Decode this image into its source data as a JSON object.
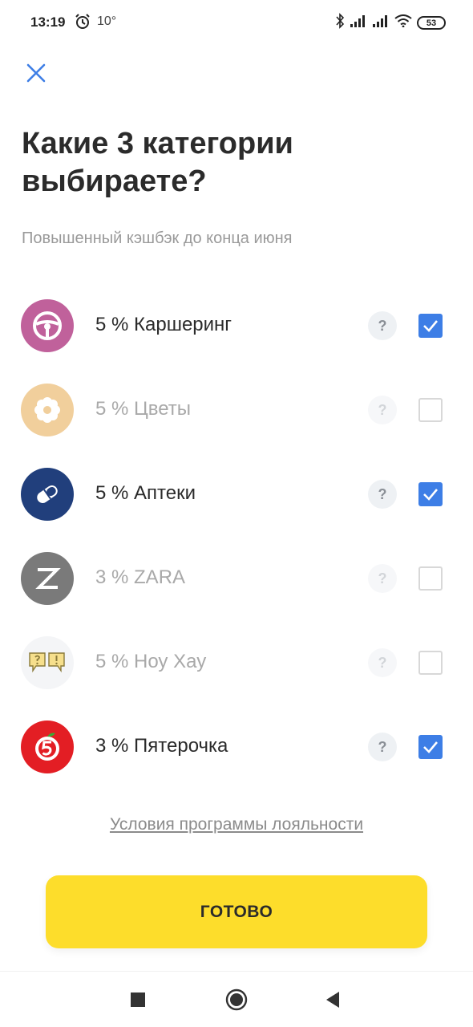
{
  "status_bar": {
    "time": "13:19",
    "temperature": "10°",
    "battery": "53",
    "icons": [
      "alarm-icon",
      "bluetooth-icon",
      "signal-icon",
      "signal-icon",
      "wifi-icon",
      "battery-icon"
    ]
  },
  "header": {
    "close_icon": "close-icon",
    "title": "Какие 3 категории выбираете?",
    "subtitle": "Повышенный кэшбэк до конца июня"
  },
  "categories": [
    {
      "label": "5 % Каршеринг",
      "icon": "steering-wheel-icon",
      "selected": true,
      "icon_color": "#c0619b"
    },
    {
      "label": "5 % Цветы",
      "icon": "flower-icon",
      "selected": false,
      "icon_color": "#f1cf9c"
    },
    {
      "label": "5 % Аптеки",
      "icon": "pill-icon",
      "selected": true,
      "icon_color": "#213f7c"
    },
    {
      "label": "3 % ZARA",
      "icon": "zara-logo-icon",
      "selected": false,
      "icon_color": "#7a7a7a"
    },
    {
      "label": "5 % Ноу Хау",
      "icon": "speech-bubbles-icon",
      "selected": false,
      "icon_color": "#f4f5f7"
    },
    {
      "label": "3 % Пятерочка",
      "icon": "pyaterochka-logo-icon",
      "selected": true,
      "icon_color": "#e31e24"
    }
  ],
  "help_label": "?",
  "loyalty_link": "Условия программы лояльности",
  "done_button": "ГОТОВО",
  "colors": {
    "accent_blue": "#3d7ee6",
    "button_yellow": "#fddd2b",
    "close_blue": "#3d7ee6"
  },
  "nav_bar": {
    "icons": [
      "recents-square-icon",
      "home-circle-icon",
      "back-triangle-icon"
    ]
  }
}
